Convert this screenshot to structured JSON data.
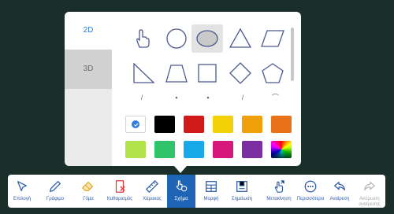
{
  "popup": {
    "tabs": [
      {
        "label": "2D"
      },
      {
        "label": "3D"
      }
    ],
    "shapes": [
      "hand-pointer",
      "circle",
      "ellipse",
      "triangle",
      "parallelogram",
      "right-triangle",
      "trapezoid",
      "square",
      "diamond",
      "pentagon"
    ],
    "selected_shape": "ellipse",
    "colors": [
      "#ffffff",
      "#000000",
      "#d11a1a",
      "#f5d10a",
      "#f0a10a",
      "#e8731a",
      "#b2e24a",
      "#2fc46a",
      "#17a9e8",
      "#d8177a",
      "#7a2ea0",
      "spectrum"
    ],
    "selected_color": "#ffffff"
  },
  "toolbar": {
    "items": [
      {
        "label": "Επιλογή",
        "icon": "select-arrow-icon"
      },
      {
        "label": "Γράφιμο",
        "icon": "pen-icon"
      },
      {
        "label": "Γόμα",
        "icon": "eraser-icon"
      },
      {
        "label": "Καθαρισμός",
        "icon": "clear-page-icon"
      },
      {
        "label": "Χάρακας",
        "icon": "ruler-icon"
      },
      {
        "label": "Σχήμα",
        "icon": "shapes-icon"
      },
      {
        "label": "Μορφή",
        "icon": "table-icon"
      },
      {
        "label": "Σημείωση",
        "icon": "note-icon"
      },
      {
        "label": "Μετακίνηση",
        "icon": "move-hand-icon"
      },
      {
        "label": "Περισσότερα",
        "icon": "more-icon"
      },
      {
        "label": "Αναίρεση",
        "icon": "undo-icon"
      },
      {
        "label": "Ακύρωση αναίρεσης",
        "icon": "redo-icon"
      }
    ],
    "active_item": "Σχήμα",
    "disabled_item": "Ακύρωση αναίρεσης"
  }
}
